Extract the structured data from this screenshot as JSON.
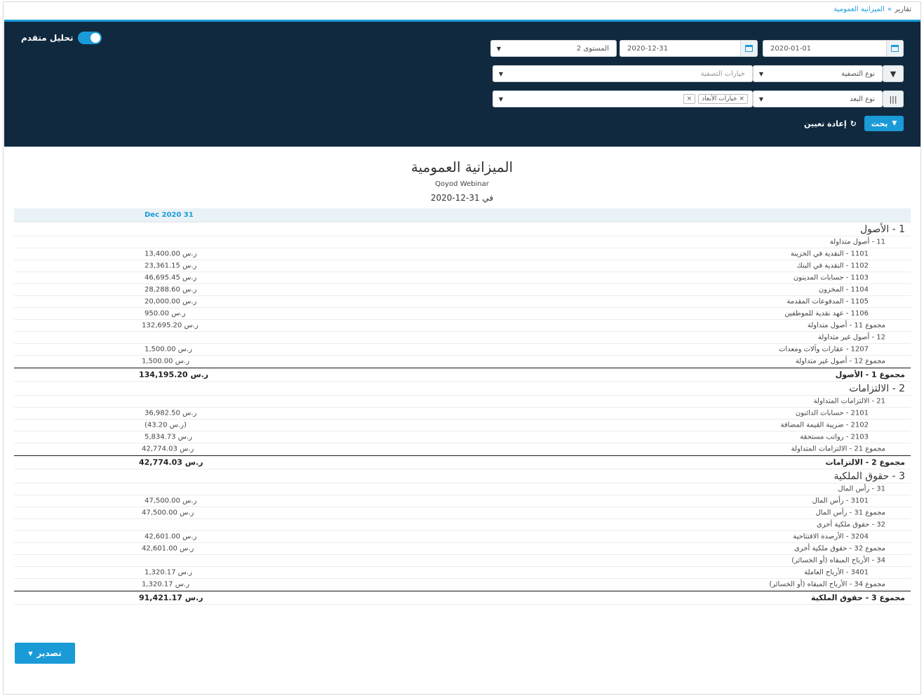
{
  "breadcrumb": {
    "root": "تقارير",
    "separator": "»",
    "current": "الميزانية العمومية"
  },
  "filters": {
    "advanced_analysis_label": "تحليل متقدم",
    "date_from": "2020-01-01",
    "date_to": "2020-12-31",
    "level": "المستوى 2",
    "filter_type_placeholder": "نوع التصفية",
    "filter_options_placeholder": "خيارات التصفية",
    "dimension_type_placeholder": "نوع البعد",
    "dimension_options_tag": "خيارات الأبعاد",
    "search_label": "بحث",
    "reset_label": "إعادة تعيين"
  },
  "report": {
    "title": "الميزانية العمومية",
    "company": "Qoyod Webinar",
    "date_line": "في 31-12-2020",
    "column_header": "Dec 2020 31",
    "currency": "ر.س",
    "rows": [
      {
        "type": "h-main",
        "label": "1 - الأصول",
        "amount": ""
      },
      {
        "type": "h-sub",
        "label": "11 - أصول متداولة",
        "amount": ""
      },
      {
        "type": "item",
        "label": "1101 - النقدية في الخزينة",
        "amount": "13,400.00"
      },
      {
        "type": "item",
        "label": "1102 - النقدية في البنك",
        "amount": "23,361.15"
      },
      {
        "type": "item",
        "label": "1103 - حسابات المدينون",
        "amount": "46,695.45"
      },
      {
        "type": "item",
        "label": "1104 - المخزون",
        "amount": "28,288.60"
      },
      {
        "type": "item",
        "label": "1105 - المدفوعات المقدمة",
        "amount": "20,000.00"
      },
      {
        "type": "item",
        "label": "1106 - عهد نقدية للموظفين",
        "amount": "950.00"
      },
      {
        "type": "subtotal",
        "label": "مجموع 11 - أصول متداولة",
        "amount": "132,695.20"
      },
      {
        "type": "h-sub",
        "label": "12 - أصول غير متداولة",
        "amount": ""
      },
      {
        "type": "item",
        "label": "1207 - عقارات وآلات ومعدات",
        "amount": "1,500.00"
      },
      {
        "type": "subtotal",
        "label": "مجموع 12 - أصول غير متداولة",
        "amount": "1,500.00"
      },
      {
        "type": "total",
        "label": "مجموع 1 - الأصول",
        "amount": "134,195.20"
      },
      {
        "type": "h-main",
        "label": "2 - الالتزامات",
        "amount": ""
      },
      {
        "type": "h-sub",
        "label": "21 - الالتزامات المتداولة",
        "amount": ""
      },
      {
        "type": "item",
        "label": "2101 - حسابات الدائنون",
        "amount": "36,982.50"
      },
      {
        "type": "item",
        "label": "2102 - ضريبة القيمة المضافة",
        "amount": "(43.20",
        "paren": true
      },
      {
        "type": "item",
        "label": "2103 - رواتب مستحقة",
        "amount": "5,834.73"
      },
      {
        "type": "subtotal",
        "label": "مجموع 21 - الالتزامات المتداولة",
        "amount": "42,774.03"
      },
      {
        "type": "total",
        "label": "مجموع 2 - الالتزامات",
        "amount": "42,774.03"
      },
      {
        "type": "h-main",
        "label": "3 - حقوق الملكية",
        "amount": ""
      },
      {
        "type": "h-sub",
        "label": "31 - رأس المال",
        "amount": ""
      },
      {
        "type": "item",
        "label": "3101 - رأس المال",
        "amount": "47,500.00"
      },
      {
        "type": "subtotal",
        "label": "مجموع 31 - رأس المال",
        "amount": "47,500.00"
      },
      {
        "type": "h-sub",
        "label": "32 - حقوق ملكية أخرى",
        "amount": ""
      },
      {
        "type": "item",
        "label": "3204 - الأرصدة الافتتاحية",
        "amount": "42,601.00"
      },
      {
        "type": "subtotal",
        "label": "مجموع 32 - حقوق ملكية أخرى",
        "amount": "42,601.00"
      },
      {
        "type": "h-sub",
        "label": "34 - الأرباح المبقاه (أو الخسائر)",
        "amount": ""
      },
      {
        "type": "item",
        "label": "3401 - الأرباح العاملة",
        "amount": "1,320.17"
      },
      {
        "type": "subtotal",
        "label": "مجموع 34 - الأرباح المبقاه (أو الخسائر)",
        "amount": "1,320.17"
      },
      {
        "type": "total",
        "label": "مجموع 3 - حقوق الملكية",
        "amount": "91,421.17"
      }
    ]
  },
  "export_label": "تصدير",
  "colors": {
    "accent": "#1a9bd7",
    "panel": "#10293f"
  }
}
